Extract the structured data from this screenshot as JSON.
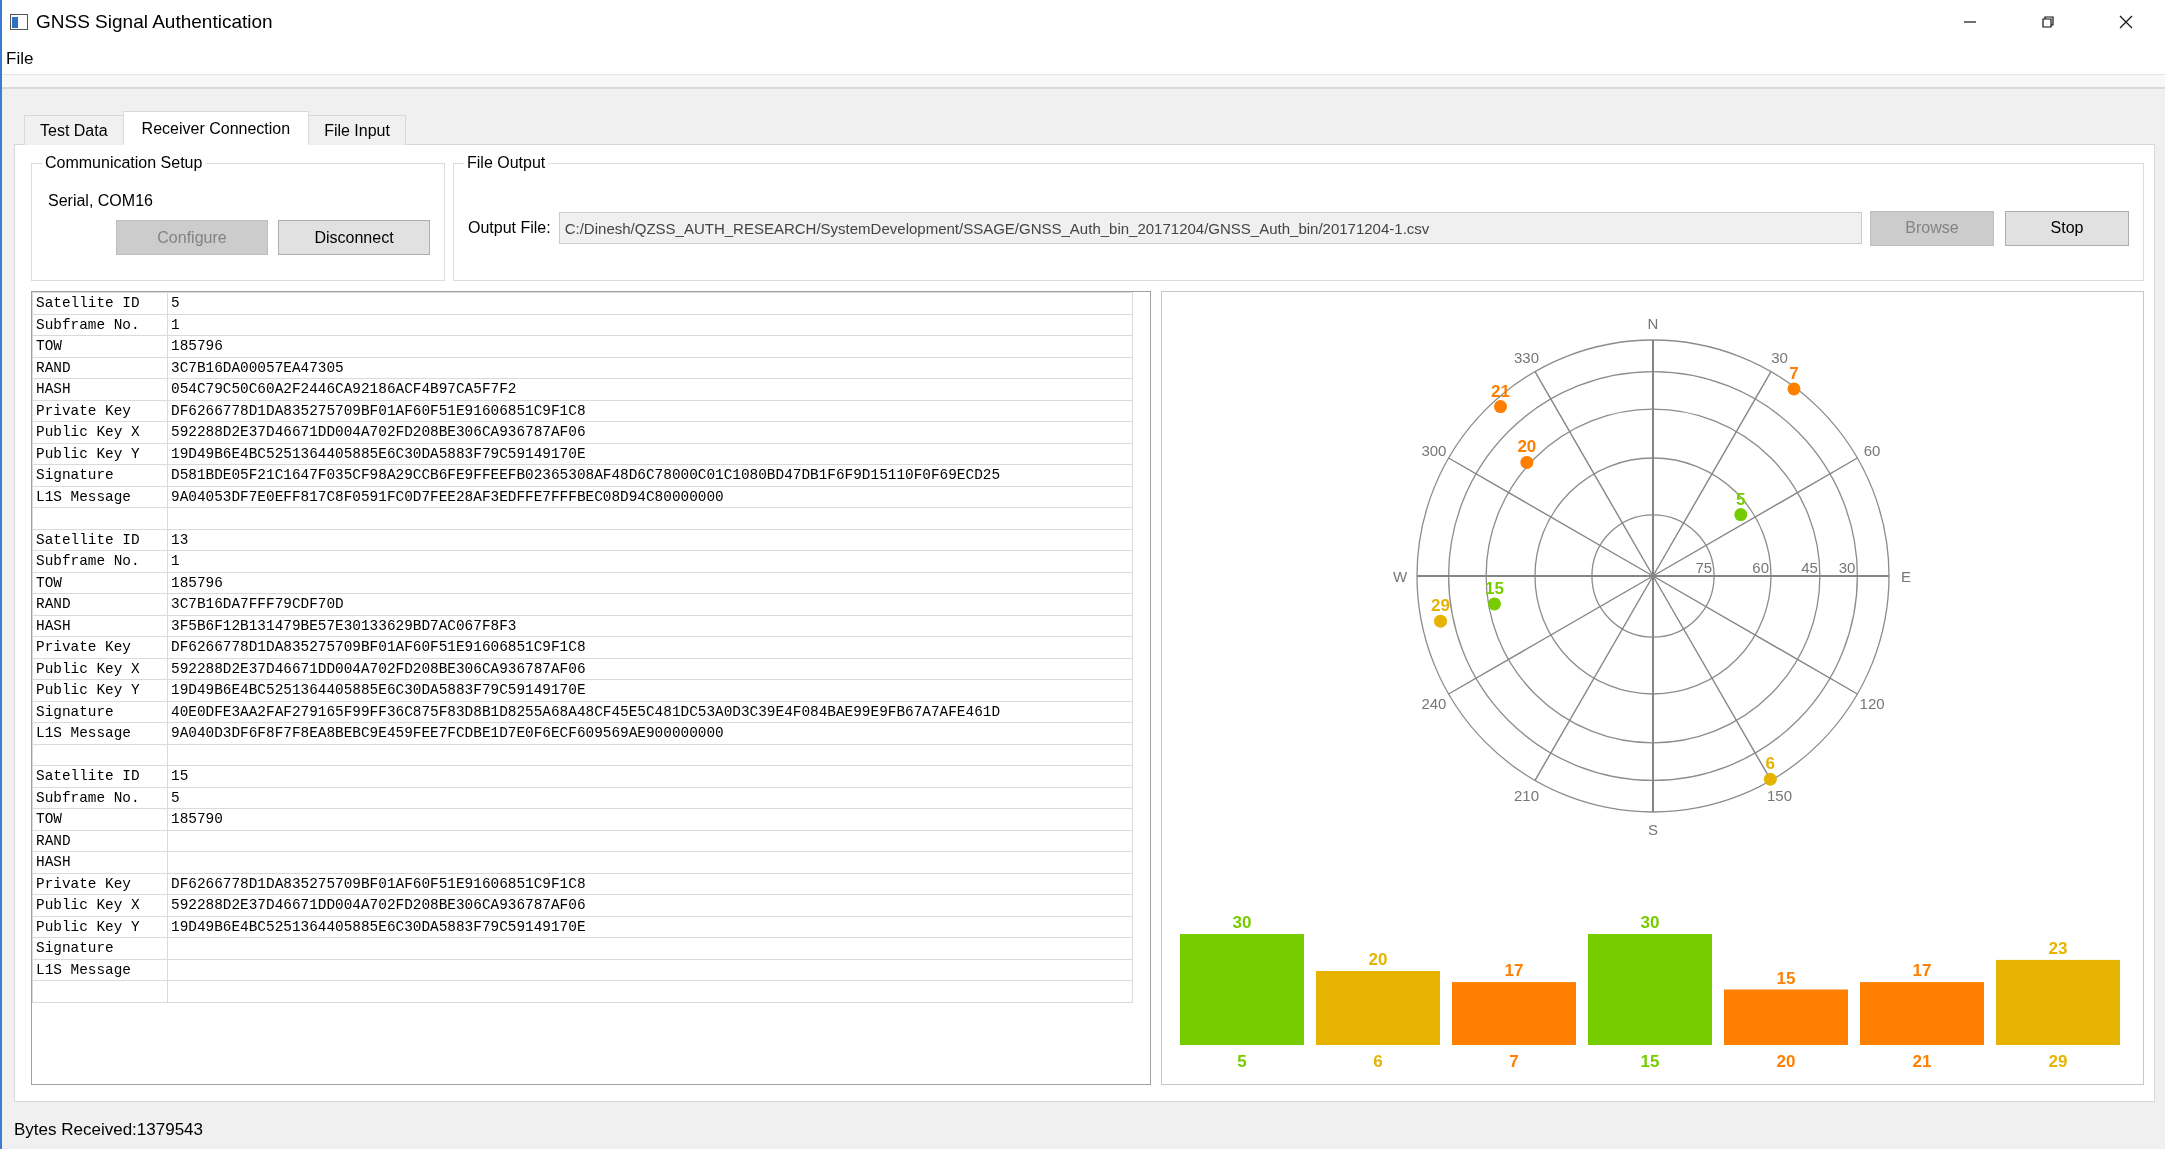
{
  "window": {
    "title": "GNSS Signal Authentication"
  },
  "menu": [
    "File"
  ],
  "tabs": [
    {
      "label": "Test Data",
      "selected": false
    },
    {
      "label": "Receiver Connection",
      "selected": true
    },
    {
      "label": "File Input",
      "selected": false
    }
  ],
  "communication_setup": {
    "title": "Communication Setup",
    "connection": "Serial, COM16",
    "buttons": [
      {
        "label": "Configure",
        "disabled": true
      },
      {
        "label": "Disconnect",
        "disabled": false
      }
    ]
  },
  "file_output": {
    "title": "File Output",
    "label": "Output File:",
    "value": "C:/Dinesh/QZSS_AUTH_RESEARCH/SystemDevelopment/SSAGE/GNSS_Auth_bin_20171204/GNSS_Auth_bin/20171204-1.csv",
    "disabled": true,
    "buttons": [
      {
        "label": "Browse",
        "disabled": true
      },
      {
        "label": "Stop",
        "disabled": false
      }
    ]
  },
  "records": [
    {
      "rows": [
        {
          "label": "Satellite ID",
          "value": "5"
        },
        {
          "label": "Subframe No.",
          "value": "1"
        },
        {
          "label": "TOW",
          "value": "185796"
        },
        {
          "label": "RAND",
          "value": "3C7B16DA00057EA47305"
        },
        {
          "label": "HASH",
          "value": "054C79C50C60A2F2446CA92186ACF4B97CA5F7F2"
        },
        {
          "label": "Private Key",
          "value": "DF6266778D1DA835275709BF01AF60F51E91606851C9F1C8"
        },
        {
          "label": "Public Key X",
          "value": "592288D2E37D46671DD004A702FD208BE306CA936787AF06"
        },
        {
          "label": "Public Key Y",
          "value": "19D49B6E4BC5251364405885E6C30DA5883F79C59149170E"
        },
        {
          "label": "Signature",
          "value": "D581BDE05F21C1647F035CF98A29CCB6FE9FFEEFB02365308AF48D6C78000C01C1080BD47DB1F6F9D15110F0F69ECD25"
        },
        {
          "label": "L1S Message",
          "value": "9A04053DF7E0EFF817C8F0591FC0D7FEE28AF3EDFFE7FFFBEC08D94C80000000"
        }
      ]
    },
    {
      "rows": [
        {
          "label": "Satellite ID",
          "value": "13"
        },
        {
          "label": "Subframe No.",
          "value": "1"
        },
        {
          "label": "TOW",
          "value": "185796"
        },
        {
          "label": "RAND",
          "value": "3C7B16DA7FFF79CDF70D"
        },
        {
          "label": "HASH",
          "value": "3F5B6F12B131479BE57E30133629BD7AC067F8F3"
        },
        {
          "label": "Private Key",
          "value": "DF6266778D1DA835275709BF01AF60F51E91606851C9F1C8"
        },
        {
          "label": "Public Key X",
          "value": "592288D2E37D46671DD004A702FD208BE306CA936787AF06"
        },
        {
          "label": "Public Key Y",
          "value": "19D49B6E4BC5251364405885E6C30DA5883F79C59149170E"
        },
        {
          "label": "Signature",
          "value": "40E0DFE3AA2FAF279165F99FF36C875F83D8B1D8255A68A48CF45E5C481DC53A0D3C39E4F084BAE99E9FB67A7AFE461D"
        },
        {
          "label": "L1S Message",
          "value": "9A040D3DF6F8F7F8EA8BEBC9E459FEE7FCDBE1D7E0F6ECF609569AE900000000"
        }
      ]
    },
    {
      "rows": [
        {
          "label": "Satellite ID",
          "value": "15"
        },
        {
          "label": "Subframe No.",
          "value": "5"
        },
        {
          "label": "TOW",
          "value": "185790"
        },
        {
          "label": "RAND"
        },
        {
          "label": "HASH"
        },
        {
          "label": "Private Key",
          "value": "DF6266778D1DA835275709BF01AF60F51E91606851C9F1C8"
        },
        {
          "label": "Public Key X",
          "value": "592288D2E37D46671DD004A702FD208BE306CA936787AF06"
        },
        {
          "label": "Public Key Y",
          "value": "19D49B6E4BC5251364405885E6C30DA5883F79C59149170E"
        },
        {
          "label": "Signature"
        },
        {
          "label": "L1S Message"
        }
      ]
    }
  ],
  "sky_plot": {
    "azimuth_labels": [
      "N",
      "30",
      "60",
      "E",
      "120",
      "150",
      "S",
      "210",
      "240",
      "W",
      "300",
      "330"
    ],
    "elevation_labels": [
      "75",
      "60",
      "45",
      "30"
    ],
    "satellites": [
      {
        "label": "21",
        "color": "#ff7f00"
      },
      {
        "label": "7",
        "color": "#ff7f00"
      },
      {
        "label": "20",
        "color": "#ff7f00"
      },
      {
        "label": "5",
        "color": "#77cc00"
      },
      {
        "label": "29",
        "color": "#e6b400"
      },
      {
        "label": "15",
        "color": "#77cc00"
      },
      {
        "label": "6",
        "color": "#e6b400"
      }
    ]
  },
  "signal_bars": {
    "chart_data": {
      "type": "bar",
      "categories": [
        "5",
        "6",
        "7",
        "15",
        "20",
        "21",
        "29"
      ],
      "data_labels": true,
      "ylim": [
        0,
        30
      ],
      "series": [
        {
          "color": "#77cc00",
          "values": [
            30,
            null,
            null,
            30,
            null,
            null,
            null
          ]
        },
        {
          "color": "#e6b400",
          "values": [
            null,
            20,
            null,
            null,
            null,
            null,
            23
          ]
        },
        {
          "color": "#ff7f00",
          "values": [
            null,
            null,
            17,
            null,
            15,
            17,
            null
          ]
        }
      ]
    }
  },
  "status_bar": "Bytes Received:1379543"
}
